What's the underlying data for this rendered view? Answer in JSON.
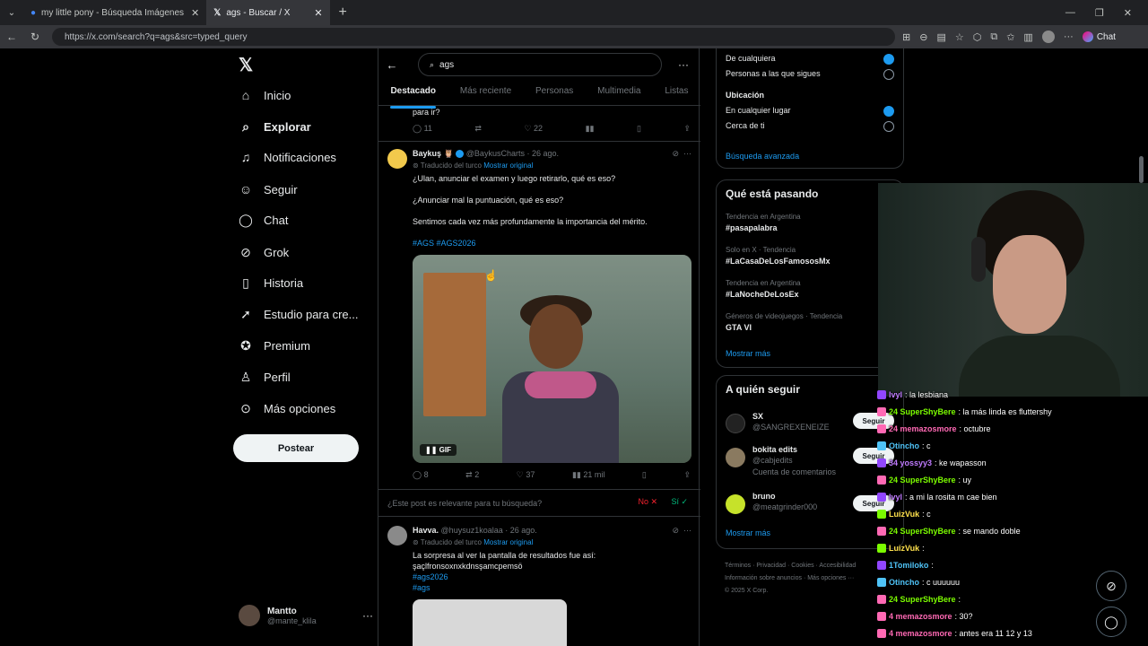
{
  "browser": {
    "tabs": [
      {
        "label": "my little pony - Búsqueda Imágenes"
      },
      {
        "label": "ags - Buscar / X"
      }
    ],
    "url": "https://x.com/search?q=ags&src=typed_query",
    "chat_label": "Chat"
  },
  "nav": {
    "items": [
      "Inicio",
      "Explorar",
      "Notificaciones",
      "Seguir",
      "Chat",
      "Grok",
      "Historia",
      "Estudio para cre...",
      "Premium",
      "Perfil",
      "Más opciones"
    ],
    "post_button": "Postear",
    "user_name": "Mantto",
    "user_handle": "@mante_klila"
  },
  "search": {
    "query": "ags",
    "tabs": [
      "Destacado",
      "Más reciente",
      "Personas",
      "Multimedia",
      "Listas"
    ]
  },
  "prev_post": {
    "text": "para ir?",
    "replies": "11",
    "likes": "22"
  },
  "post1": {
    "name": "Baykuş",
    "emoji": "🦉",
    "handle": "@BaykusCharts · 26 ago.",
    "translated": "Traducido del turco",
    "show_original": "Mostrar original",
    "line1": "¿Ulan, anunciar el examen y luego retirarlo, qué es eso?",
    "line2": "¿Anunciar mal la puntuación, qué es eso?",
    "line3": "Sentimos cada vez más profundamente la importancia del mérito.",
    "hashtags": "#AGS #AGS2026",
    "gif_label": "GIF",
    "replies": "8",
    "reposts": "2",
    "likes": "37",
    "views": "21 mil"
  },
  "relevance": {
    "question": "¿Este post es relevante para tu búsqueda?",
    "no": "No ✕",
    "yes": "Sí ✓"
  },
  "post2": {
    "name": "Havva.",
    "handle": "@huysuz1koalaa · 26 ago.",
    "translated": "Traducido del turco",
    "show_original": "Mostrar original",
    "line1": "La sorpresa al ver la pantalla de resultados fue así:",
    "line2": "şaçlfronsoxnxkdnsşamcpemsö",
    "tag1": "#ags2026",
    "tag2": "#ags"
  },
  "filters": {
    "opt1": "De cualquiera",
    "opt2": "Personas a las que sigues",
    "location_title": "Ubicación",
    "loc1": "En cualquier lugar",
    "loc2": "Cerca de ti",
    "advanced": "Búsqueda avanzada"
  },
  "trends": {
    "title": "Qué está pasando",
    "items": [
      {
        "meta": "Tendencia en Argentina",
        "name": "#pasapalabra"
      },
      {
        "meta": "Solo en X · Tendencia",
        "name": "#LaCasaDeLosFamososMx"
      },
      {
        "meta": "Tendencia en Argentina",
        "name": "#LaNocheDeLosEx"
      },
      {
        "meta": "Géneros de videojuegos · Tendencia",
        "name": "GTA VI"
      }
    ],
    "show_more": "Mostrar más"
  },
  "follow": {
    "title": "A quién seguir",
    "items": [
      {
        "name": "SX",
        "handle": "@SANGREXENEIZE"
      },
      {
        "name": "bokita edits",
        "handle": "@cabjedits",
        "extra": "Cuenta de comentarios"
      },
      {
        "name": "bruno",
        "handle": "@meatgrinder000"
      }
    ],
    "follow_label": "Seguir",
    "show_more": "Mostrar más"
  },
  "footer": {
    "line1": "Términos · Privacidad · Cookies · Accesibilidad",
    "line2": "Información sobre anuncios · Más opciones ···",
    "line3": "© 2025 X Corp."
  },
  "chat": [
    {
      "user": "lvyl",
      "msg": ": la lesbiana",
      "color": "u-purple"
    },
    {
      "user": "24 SuperShyBere",
      "msg": ": la más linda es fluttershy",
      "color": "u-green"
    },
    {
      "user": "24 memazosmore",
      "msg": ": octubre",
      "color": "u-pink"
    },
    {
      "user": "Otincho",
      "msg": ": c",
      "color": "u-blue"
    },
    {
      "user": "34 yossyy3",
      "msg": ": ke wapasson",
      "color": "u-purple"
    },
    {
      "user": "24 SuperShyBere",
      "msg": ": uy",
      "color": "u-green"
    },
    {
      "user": "lvyl",
      "msg": ": a mi la rosita m cae bien",
      "color": "u-purple"
    },
    {
      "user": "LuizVuk",
      "msg": ": c",
      "color": "u-yellow"
    },
    {
      "user": "24 SuperShyBere",
      "msg": ": se mando doble",
      "color": "u-green"
    },
    {
      "user": "LuizVuk",
      "msg": ":",
      "color": "u-yellow"
    },
    {
      "user": "1Tomiloko",
      "msg": ":",
      "color": "u-blue"
    },
    {
      "user": "Otincho",
      "msg": ": c uuuuuu",
      "color": "u-blue"
    },
    {
      "user": "24 SuperShyBere",
      "msg": ":",
      "color": "u-green"
    },
    {
      "user": "4 memazosmore",
      "msg": ": 30?",
      "color": "u-pink"
    },
    {
      "user": "4 memazosmore",
      "msg": ": antes era 11 12 y 13",
      "color": "u-pink"
    }
  ]
}
